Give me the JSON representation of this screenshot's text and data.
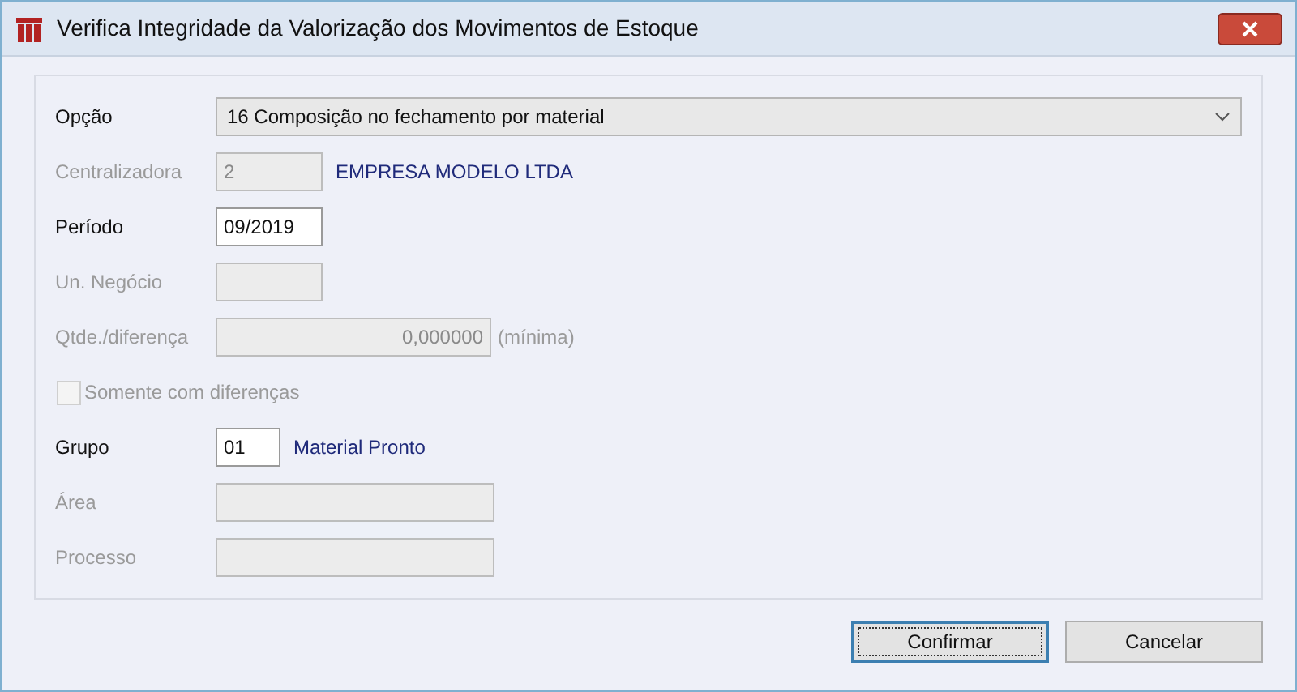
{
  "window": {
    "title": "Verifica Integridade da Valorização dos Movimentos de Estoque"
  },
  "rows": [
    {
      "kind": "combo",
      "label": "Opção",
      "value": "16 Composição no fechamento por material",
      "disabled": false
    },
    {
      "kind": "code",
      "label": "Centralizadora",
      "value": "2",
      "description": "EMPRESA MODELO LTDA",
      "disabled": true
    },
    {
      "kind": "code",
      "label": "Período",
      "value": "09/2019",
      "disabled": false
    },
    {
      "kind": "code",
      "label": "Un. Negócio",
      "disabled": true
    },
    {
      "kind": "number",
      "label": "Qtde./diferença",
      "value": "0,000000",
      "suffix": "(mínima)",
      "disabled": true
    },
    {
      "kind": "checkbox",
      "label": "Somente com diferenças",
      "checked": false,
      "disabled": true
    },
    {
      "kind": "short",
      "label": "Grupo",
      "value": "01",
      "description": "Material Pronto",
      "disabled": false
    },
    {
      "kind": "wide",
      "label": "Área",
      "disabled": true
    },
    {
      "kind": "wide",
      "label": "Processo",
      "disabled": true
    }
  ],
  "buttons": [
    {
      "label": "Confirmar",
      "focused": true
    },
    {
      "label": "Cancelar",
      "focused": false
    }
  ]
}
